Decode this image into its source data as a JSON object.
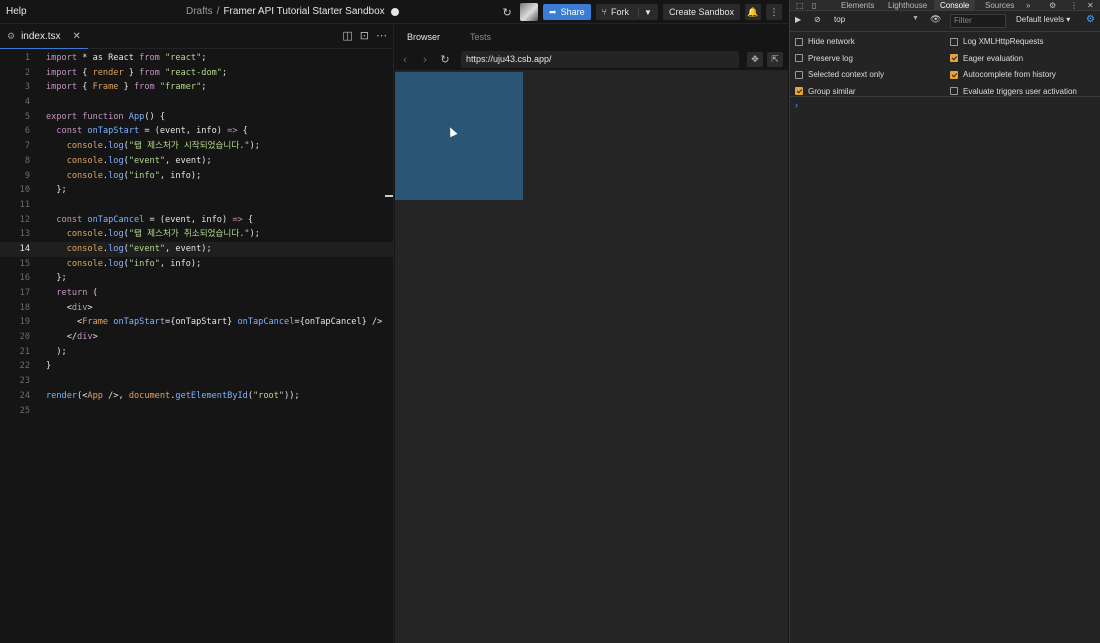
{
  "topbar": {
    "help": "Help",
    "drafts": "Drafts",
    "separator": "/",
    "title": "Framer API Tutorial Starter Sandbox",
    "share": "Share",
    "fork": "Fork",
    "create": "Create Sandbox"
  },
  "editor": {
    "tab_label": "index.tsx",
    "active_line": 14,
    "lines": [
      {
        "n": "1",
        "parts": [
          [
            "kw",
            "import"
          ],
          [
            "p",
            " * as React "
          ],
          [
            "kw",
            "from"
          ],
          [
            "p",
            " "
          ],
          [
            "str",
            "\"react\""
          ],
          [
            "p",
            ";"
          ]
        ]
      },
      {
        "n": "2",
        "parts": [
          [
            "kw",
            "import"
          ],
          [
            "p",
            " { "
          ],
          [
            "cmp",
            "render"
          ],
          [
            "p",
            " } "
          ],
          [
            "kw",
            "from"
          ],
          [
            "p",
            " "
          ],
          [
            "str",
            "\"react-dom\""
          ],
          [
            "p",
            ";"
          ]
        ]
      },
      {
        "n": "3",
        "parts": [
          [
            "kw",
            "import"
          ],
          [
            "p",
            " { "
          ],
          [
            "cmp",
            "Frame"
          ],
          [
            "p",
            " } "
          ],
          [
            "kw",
            "from"
          ],
          [
            "p",
            " "
          ],
          [
            "str",
            "\"framer\""
          ],
          [
            "p",
            ";"
          ]
        ]
      },
      {
        "n": "4",
        "parts": []
      },
      {
        "n": "5",
        "parts": [
          [
            "kw",
            "export function"
          ],
          [
            "p",
            " "
          ],
          [
            "fn",
            "App"
          ],
          [
            "p",
            "() {"
          ]
        ]
      },
      {
        "n": "6",
        "parts": [
          [
            "p",
            "  "
          ],
          [
            "kw",
            "const"
          ],
          [
            "p",
            " "
          ],
          [
            "fn",
            "onTapStart"
          ],
          [
            "p",
            " = (event, info) "
          ],
          [
            "kw",
            "=>"
          ],
          [
            "p",
            " {"
          ]
        ]
      },
      {
        "n": "7",
        "parts": [
          [
            "p",
            "    "
          ],
          [
            "cmp",
            "console"
          ],
          [
            "p",
            "."
          ],
          [
            "fn",
            "log"
          ],
          [
            "p",
            "("
          ],
          [
            "str",
            "\"탭 제스처가 시작되었습니다.\""
          ],
          [
            "p",
            ");"
          ]
        ]
      },
      {
        "n": "8",
        "parts": [
          [
            "p",
            "    "
          ],
          [
            "cmp",
            "console"
          ],
          [
            "p",
            "."
          ],
          [
            "fn",
            "log"
          ],
          [
            "p",
            "("
          ],
          [
            "str",
            "\"event\""
          ],
          [
            "p",
            ", event);"
          ]
        ]
      },
      {
        "n": "9",
        "parts": [
          [
            "p",
            "    "
          ],
          [
            "cmp",
            "console"
          ],
          [
            "p",
            "."
          ],
          [
            "fn",
            "log"
          ],
          [
            "p",
            "("
          ],
          [
            "str",
            "\"info\""
          ],
          [
            "p",
            ", info);"
          ]
        ]
      },
      {
        "n": "10",
        "parts": [
          [
            "p",
            "  };"
          ]
        ]
      },
      {
        "n": "11",
        "parts": []
      },
      {
        "n": "12",
        "parts": [
          [
            "p",
            "  "
          ],
          [
            "kw",
            "const"
          ],
          [
            "p",
            " "
          ],
          [
            "fn",
            "onTapCancel"
          ],
          [
            "p",
            " = (event, info) "
          ],
          [
            "kw",
            "=>"
          ],
          [
            "p",
            " {"
          ]
        ]
      },
      {
        "n": "13",
        "parts": [
          [
            "p",
            "    "
          ],
          [
            "cmp",
            "console"
          ],
          [
            "p",
            "."
          ],
          [
            "fn",
            "log"
          ],
          [
            "p",
            "("
          ],
          [
            "str",
            "\"탭 제스처가 취소되었습니다.\""
          ],
          [
            "p",
            ");"
          ]
        ]
      },
      {
        "n": "14",
        "parts": [
          [
            "p",
            "    "
          ],
          [
            "cmp",
            "console"
          ],
          [
            "p",
            "."
          ],
          [
            "fn",
            "log"
          ],
          [
            "p",
            "("
          ],
          [
            "str",
            "\"event\""
          ],
          [
            "p",
            ", event);"
          ]
        ]
      },
      {
        "n": "15",
        "parts": [
          [
            "p",
            "    "
          ],
          [
            "cmp",
            "console"
          ],
          [
            "p",
            "."
          ],
          [
            "fn",
            "log"
          ],
          [
            "p",
            "("
          ],
          [
            "str",
            "\"info\""
          ],
          [
            "p",
            ", info);"
          ]
        ]
      },
      {
        "n": "16",
        "parts": [
          [
            "p",
            "  };"
          ]
        ]
      },
      {
        "n": "17",
        "parts": [
          [
            "p",
            "  "
          ],
          [
            "kw",
            "return"
          ],
          [
            "p",
            " ("
          ]
        ]
      },
      {
        "n": "18",
        "parts": [
          [
            "p",
            "    <"
          ],
          [
            "kw",
            "div"
          ],
          [
            "p",
            ">"
          ]
        ]
      },
      {
        "n": "19",
        "parts": [
          [
            "p",
            "      <"
          ],
          [
            "cmp",
            "Frame"
          ],
          [
            "p",
            " "
          ],
          [
            "fn",
            "onTapStart"
          ],
          [
            "p",
            "={onTapStart} "
          ],
          [
            "fn",
            "onTapCancel"
          ],
          [
            "p",
            "={onTapCancel} />"
          ]
        ]
      },
      {
        "n": "20",
        "parts": [
          [
            "p",
            "    </"
          ],
          [
            "kw",
            "div"
          ],
          [
            "p",
            ">"
          ]
        ]
      },
      {
        "n": "21",
        "parts": [
          [
            "p",
            "  );"
          ]
        ]
      },
      {
        "n": "22",
        "parts": [
          [
            "p",
            "}"
          ]
        ]
      },
      {
        "n": "23",
        "parts": []
      },
      {
        "n": "24",
        "parts": [
          [
            "fn",
            "render"
          ],
          [
            "p",
            "(<"
          ],
          [
            "cmp",
            "App"
          ],
          [
            "p",
            " />, "
          ],
          [
            "cmp",
            "document"
          ],
          [
            "p",
            "."
          ],
          [
            "fn",
            "getElementById"
          ],
          [
            "p",
            "("
          ],
          [
            "str",
            "\"root\""
          ],
          [
            "p",
            "));"
          ]
        ]
      },
      {
        "n": "25",
        "parts": []
      }
    ]
  },
  "browser": {
    "tab_browser": "Browser",
    "tab_tests": "Tests",
    "url": "https://uju43.csb.app/",
    "frame_color": "#2b5575"
  },
  "devtools": {
    "tabs": [
      "Elements",
      "Lighthouse",
      "Console",
      "Sources"
    ],
    "active_tab": "Console",
    "context": "top",
    "filter_placeholder": "Filter",
    "levels": "Default levels ▾",
    "options_left": [
      {
        "label": "Hide network",
        "checked": false
      },
      {
        "label": "Preserve log",
        "checked": false
      },
      {
        "label": "Selected context only",
        "checked": false
      },
      {
        "label": "Group similar",
        "checked": true
      }
    ],
    "options_right": [
      {
        "label": "Log XMLHttpRequests",
        "checked": false
      },
      {
        "label": "Eager evaluation",
        "checked": true
      },
      {
        "label": "Autocomplete from history",
        "checked": true
      },
      {
        "label": "Evaluate triggers user activation",
        "checked": false
      }
    ],
    "prompt": "›"
  }
}
